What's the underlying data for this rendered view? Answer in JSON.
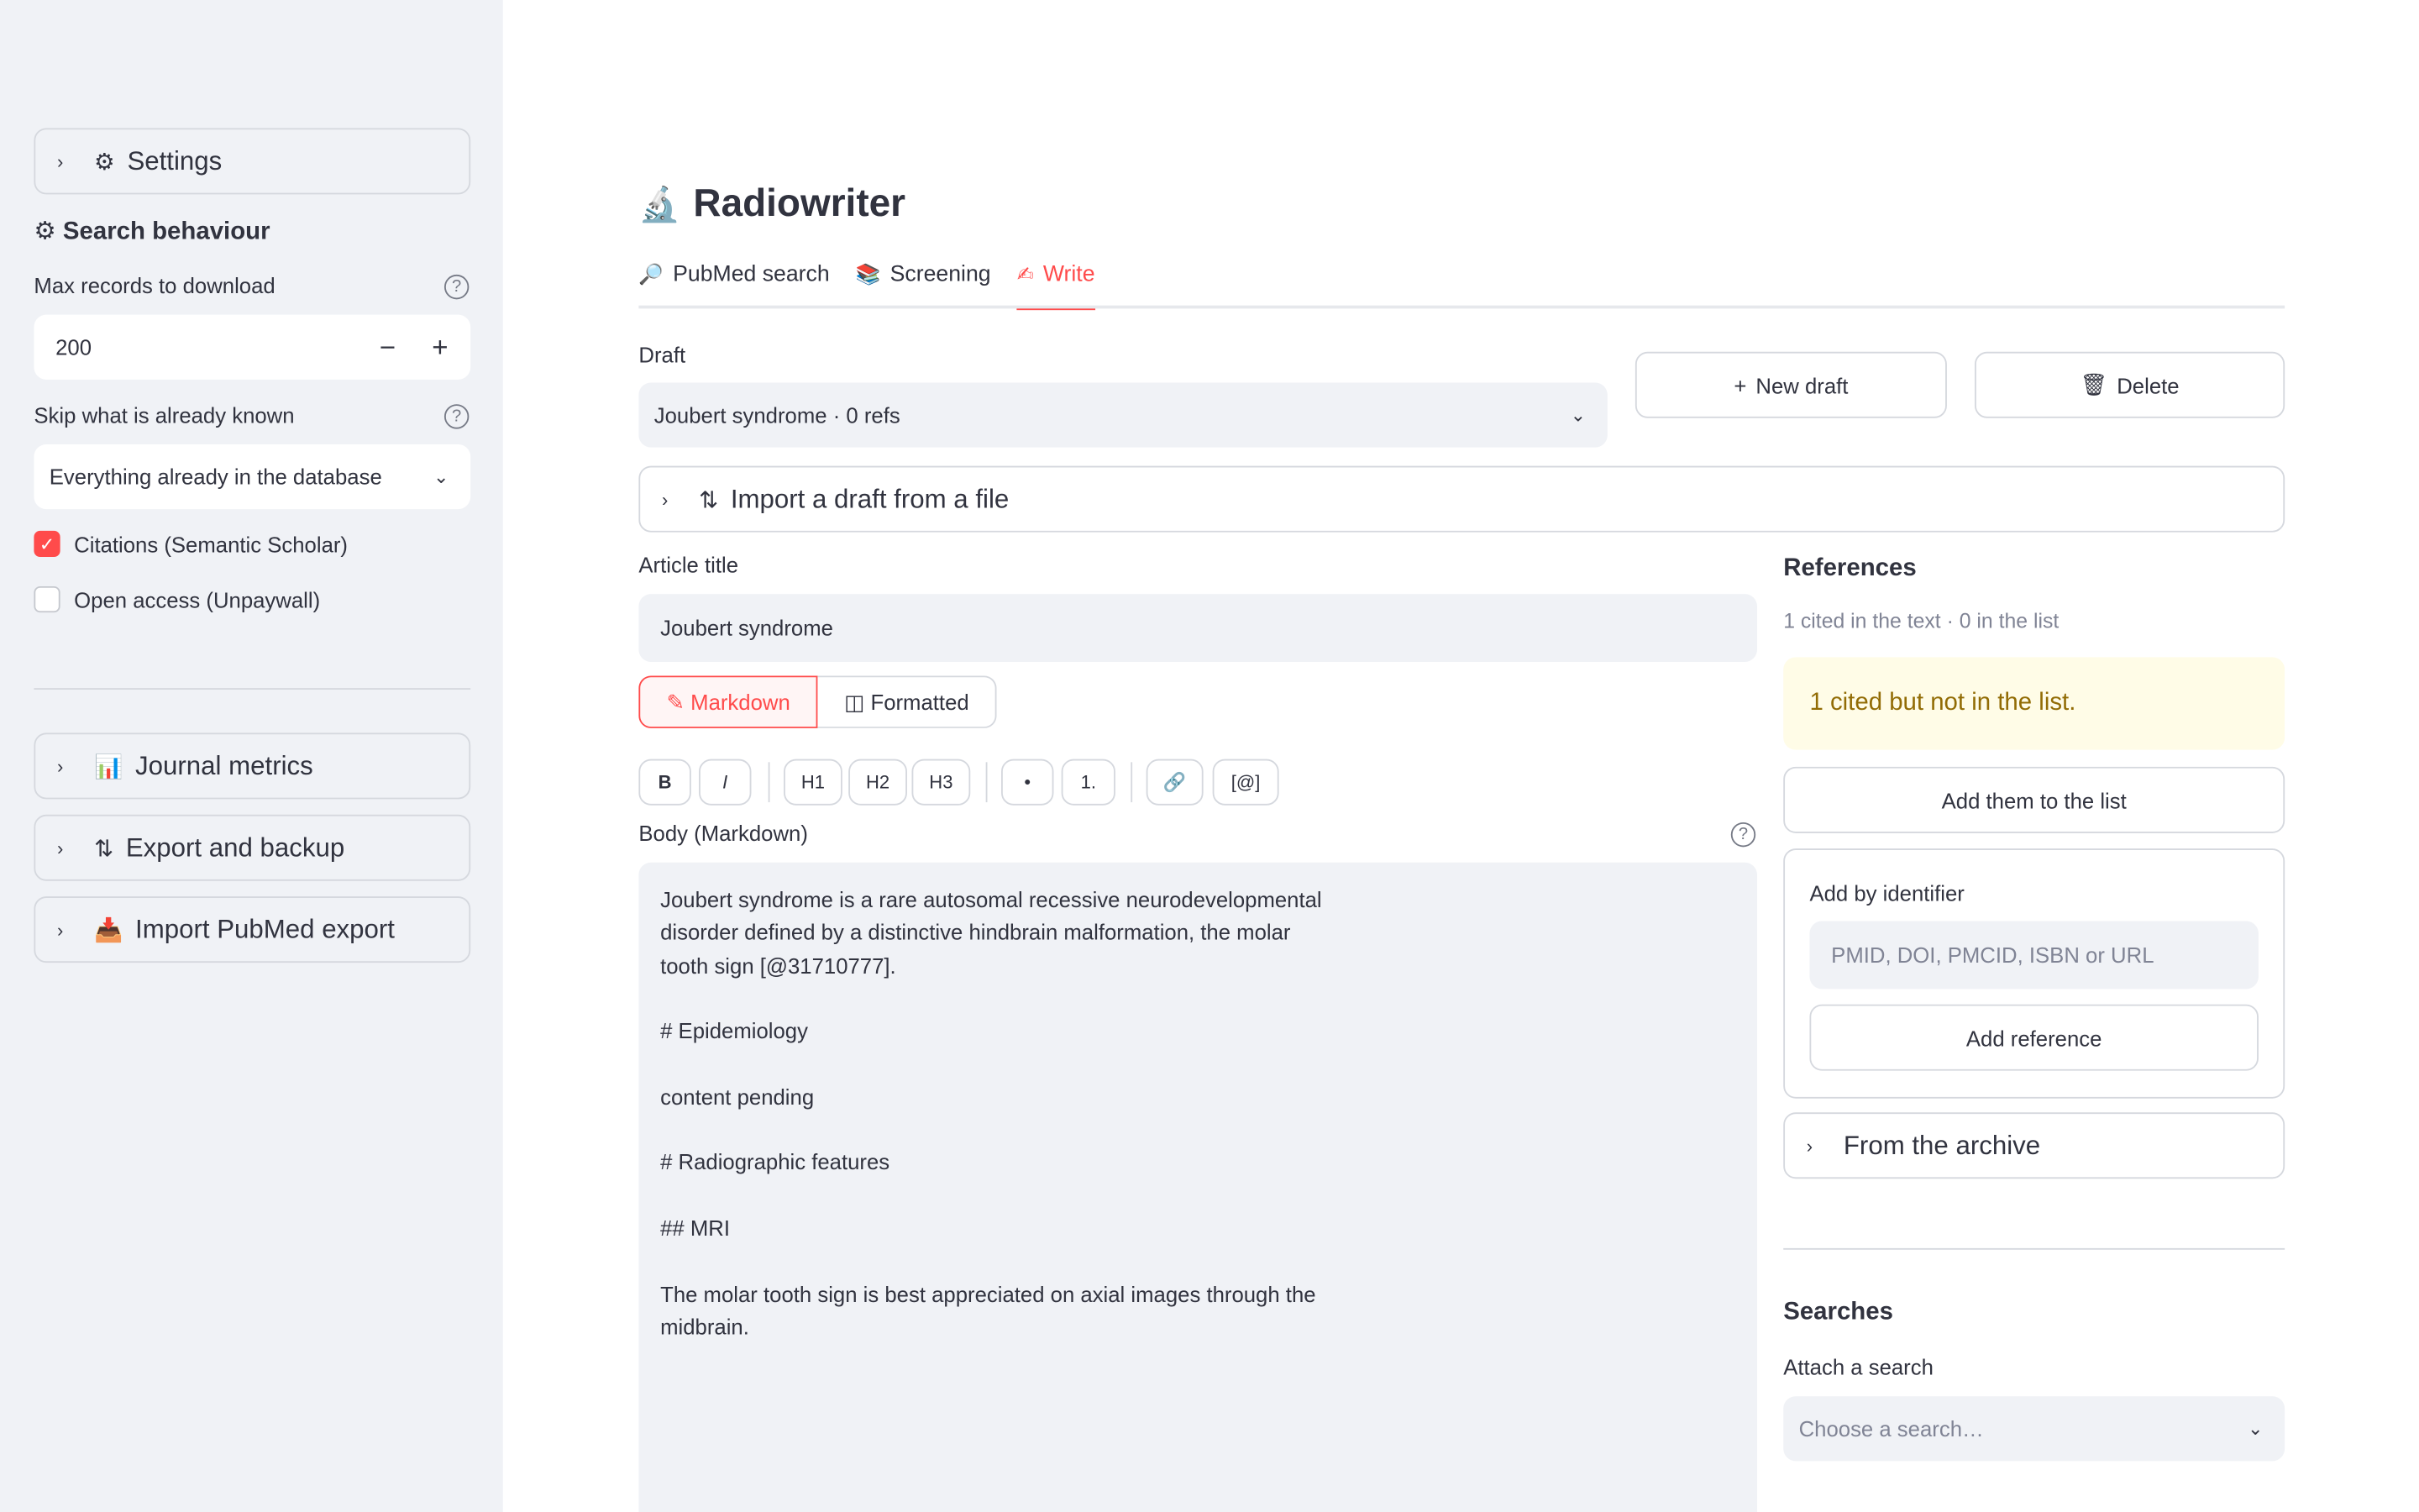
{
  "sidebar": {
    "settings": {
      "icon": "gear-icon",
      "label": "Settings"
    },
    "search_behaviour_heading": "⚙ Search behaviour",
    "max_records": {
      "label": "Max records to download",
      "value": "200",
      "decrement": "−",
      "increment": "+"
    },
    "skip_known": {
      "label": "Skip what is already known",
      "value": "Everything already in the database"
    },
    "checkboxes": [
      {
        "label": "Citations (Semantic Scholar)",
        "checked": true
      },
      {
        "label": "Open access (Unpaywall)",
        "checked": false
      }
    ],
    "expanders": [
      {
        "icon": "bar-chart-icon",
        "label": "Journal metrics"
      },
      {
        "icon": "up-down-arrows-icon",
        "label": "Export and backup"
      },
      {
        "icon": "inbox-tray-icon",
        "label": "Import PubMed export"
      }
    ]
  },
  "app": {
    "title": "Radiowriter",
    "title_icon": "microscope-icon"
  },
  "tabs": [
    {
      "label": "PubMed search",
      "icon": "magnifier-icon",
      "active": false
    },
    {
      "label": "Screening",
      "icon": "books-icon",
      "active": false
    },
    {
      "label": "Write",
      "icon": "writing-hand-icon",
      "active": true
    }
  ],
  "draft": {
    "label": "Draft",
    "selected": "Joubert syndrome · 0 refs",
    "new_draft": "New draft",
    "delete": "Delete",
    "import_expander": "Import a draft from a file"
  },
  "article": {
    "title_label": "Article title",
    "title_value": "Joubert syndrome"
  },
  "editor": {
    "mode_markdown": "✎ Markdown",
    "mode_formatted": "◫ Formatted",
    "toolbar": [
      "B",
      "I",
      "H1",
      "H2",
      "H3",
      "•",
      "1.",
      "🔗",
      "[@]"
    ],
    "body_label": "Body (Markdown)",
    "body_text": "Joubert syndrome is a rare autosomal recessive neurodevelopmental\ndisorder defined by a distinctive hindbrain malformation, the molar\ntooth sign [@31710777].\n\n# Epidemiology\n\ncontent pending\n\n# Radiographic features\n\n## MRI\n\nThe molar tooth sign is best appreciated on axial images through the\nmidbrain."
  },
  "references": {
    "heading": "References",
    "caption": "1 cited in the text · 0 in the list",
    "warning": "1 cited but not in the list.",
    "add_them": "Add them to the list",
    "add_by_identifier": "Add by identifier",
    "identifier_placeholder": "PMID, DOI, PMCID, ISBN or URL",
    "add_reference": "Add reference",
    "from_archive": "From the archive"
  },
  "searches": {
    "heading": "Searches",
    "attach_label": "Attach a search",
    "placeholder": "Choose a search…"
  },
  "colors": {
    "accent": "#ff4b4b",
    "sidebar_bg": "#f0f2f6",
    "warning_bg": "#fffce7",
    "warning_text": "#926c05"
  }
}
